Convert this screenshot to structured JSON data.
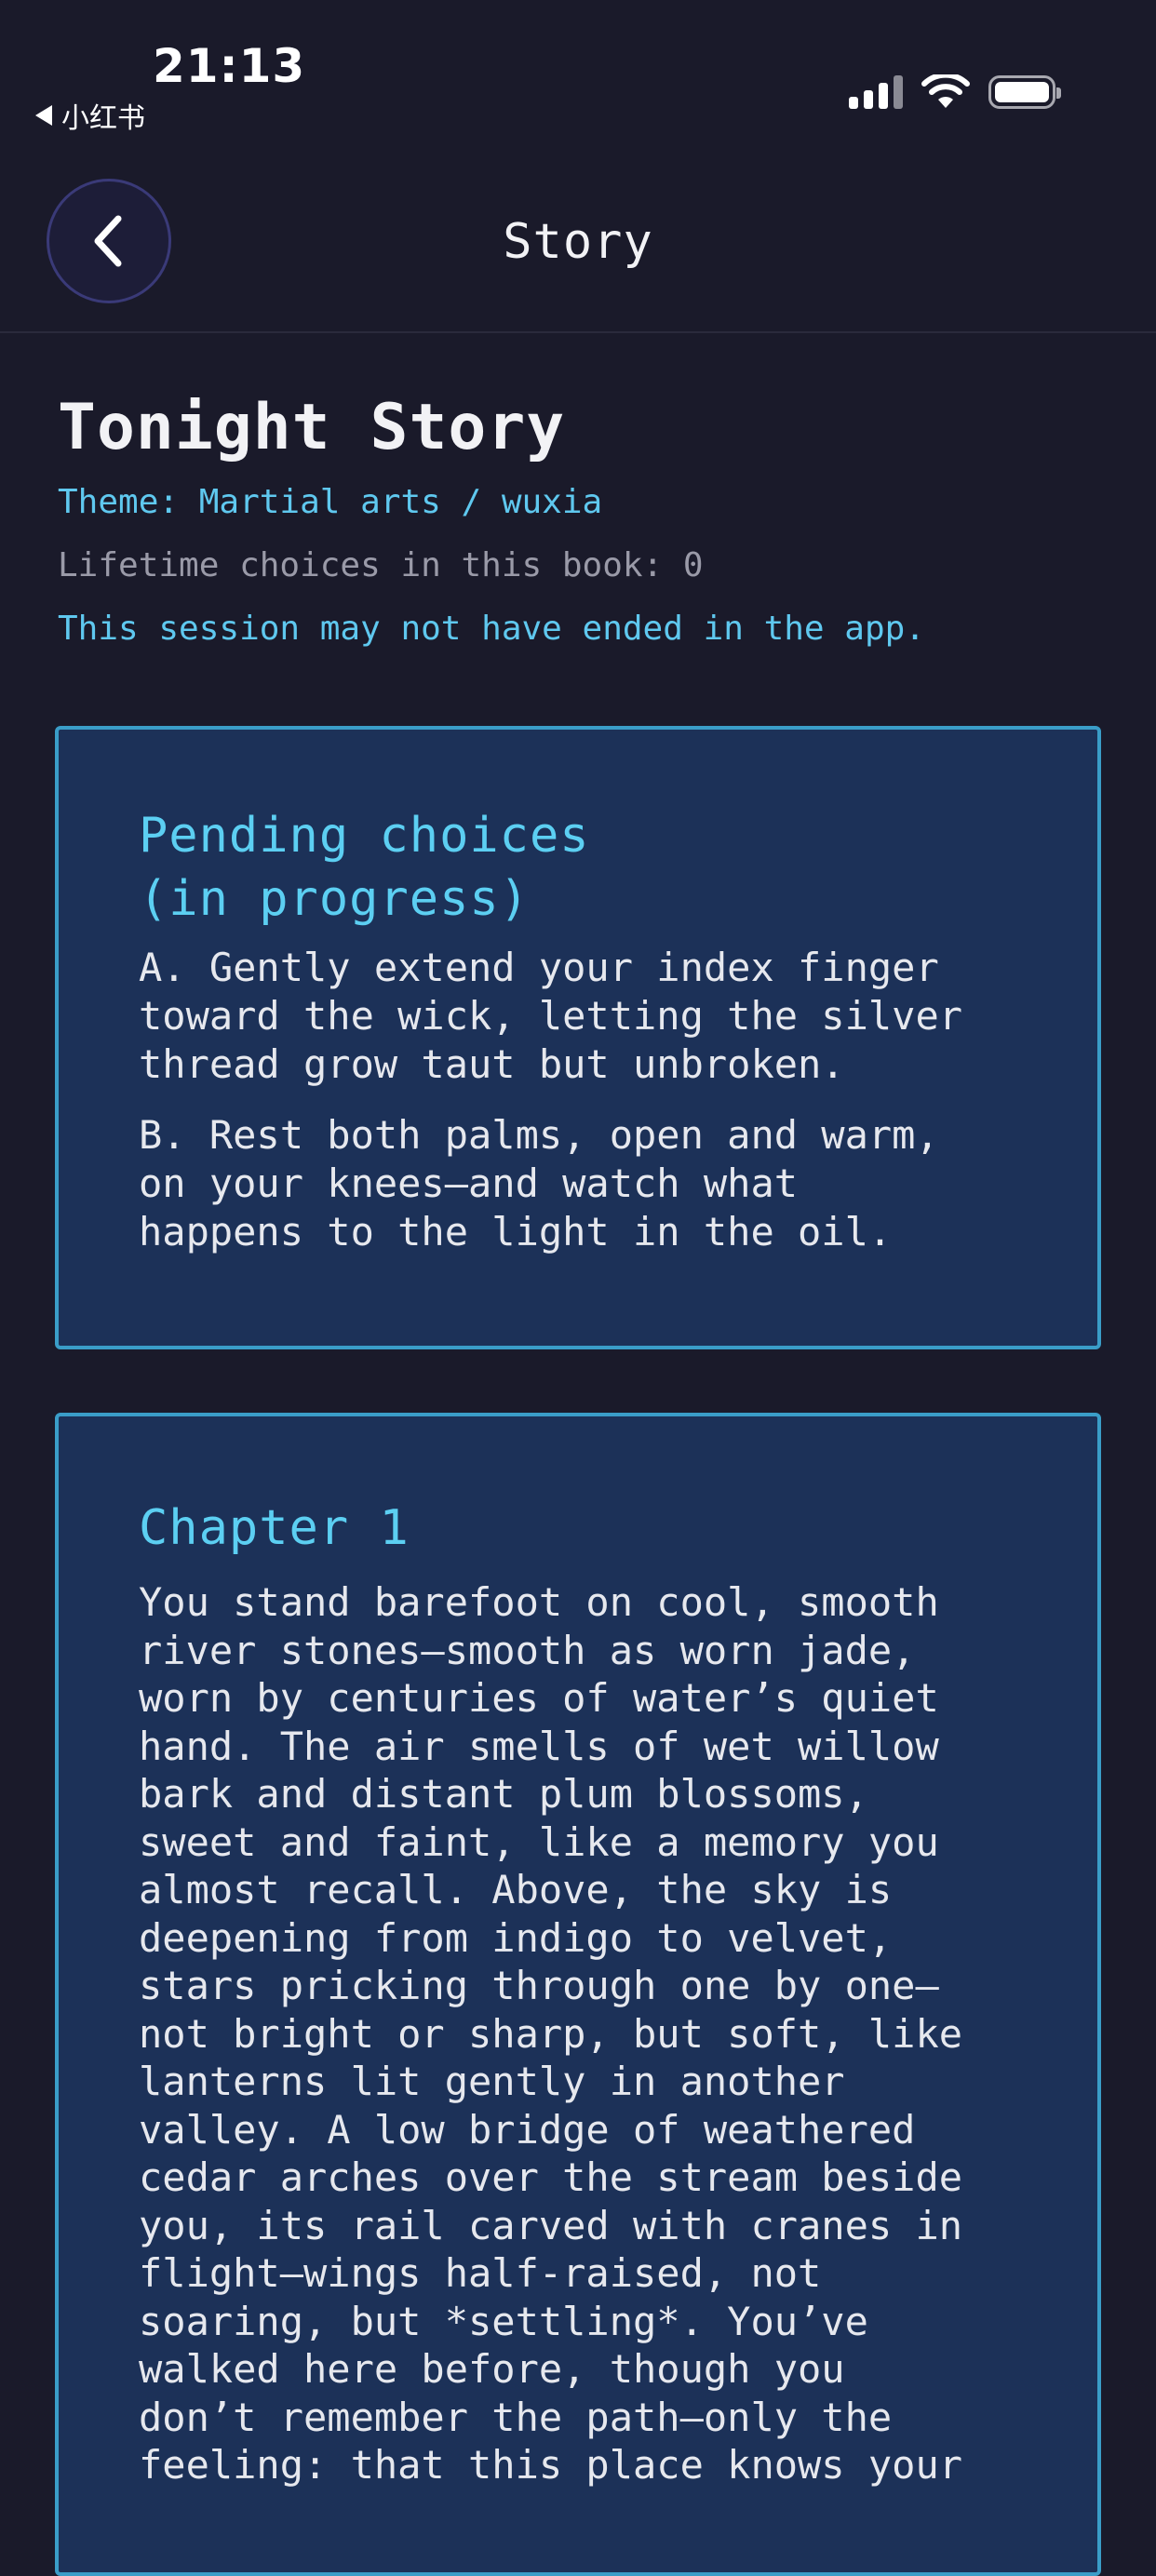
{
  "status_bar": {
    "time": "21:13",
    "back_app": "小红书",
    "icons": [
      "cellular-signal-icon",
      "wifi-icon",
      "battery-icon"
    ]
  },
  "header": {
    "title": "Story",
    "back_icon": "chevron-left-icon"
  },
  "story": {
    "title": "Tonight Story",
    "theme": "Theme: Martial arts / wuxia",
    "lifetime_choices": "Lifetime choices in this book: 0",
    "session_notice": "This session may not have ended in the app."
  },
  "pending": {
    "heading": "Pending choices\n(in progress)",
    "choices": [
      "A. Gently extend your index finger\ntoward the wick, letting the silver\nthread grow taut but unbroken.",
      "B. Rest both palms, open and warm,\non your knees—and watch what\nhappens to the light in the oil."
    ]
  },
  "chapter": {
    "heading": "Chapter 1",
    "body": "You stand barefoot on cool, smooth\nriver stones—smooth as worn jade,\nworn by centuries of water’s quiet\nhand. The air smells of wet willow\nbark and distant plum blossoms,\nsweet and faint, like a memory you\nalmost recall. Above, the sky is\ndeepening from indigo to velvet,\nstars pricking through one by one—\nnot bright or sharp, but soft, like\nlanterns lit gently in another\nvalley. A low bridge of weathered\ncedar arches over the stream beside\nyou, its rail carved with cranes in\nflight—wings half-raised, not\nsoaring, but *settling*. You’ve\nwalked here before, though you\ndon’t remember the path—only the\nfeeling: that this place knows your"
  },
  "colors": {
    "background": "#1a1a2a",
    "card_background": "#1c3158",
    "card_border": "#3a9dc8",
    "accent": "#5fc8ef",
    "muted": "#9a9aa8"
  }
}
